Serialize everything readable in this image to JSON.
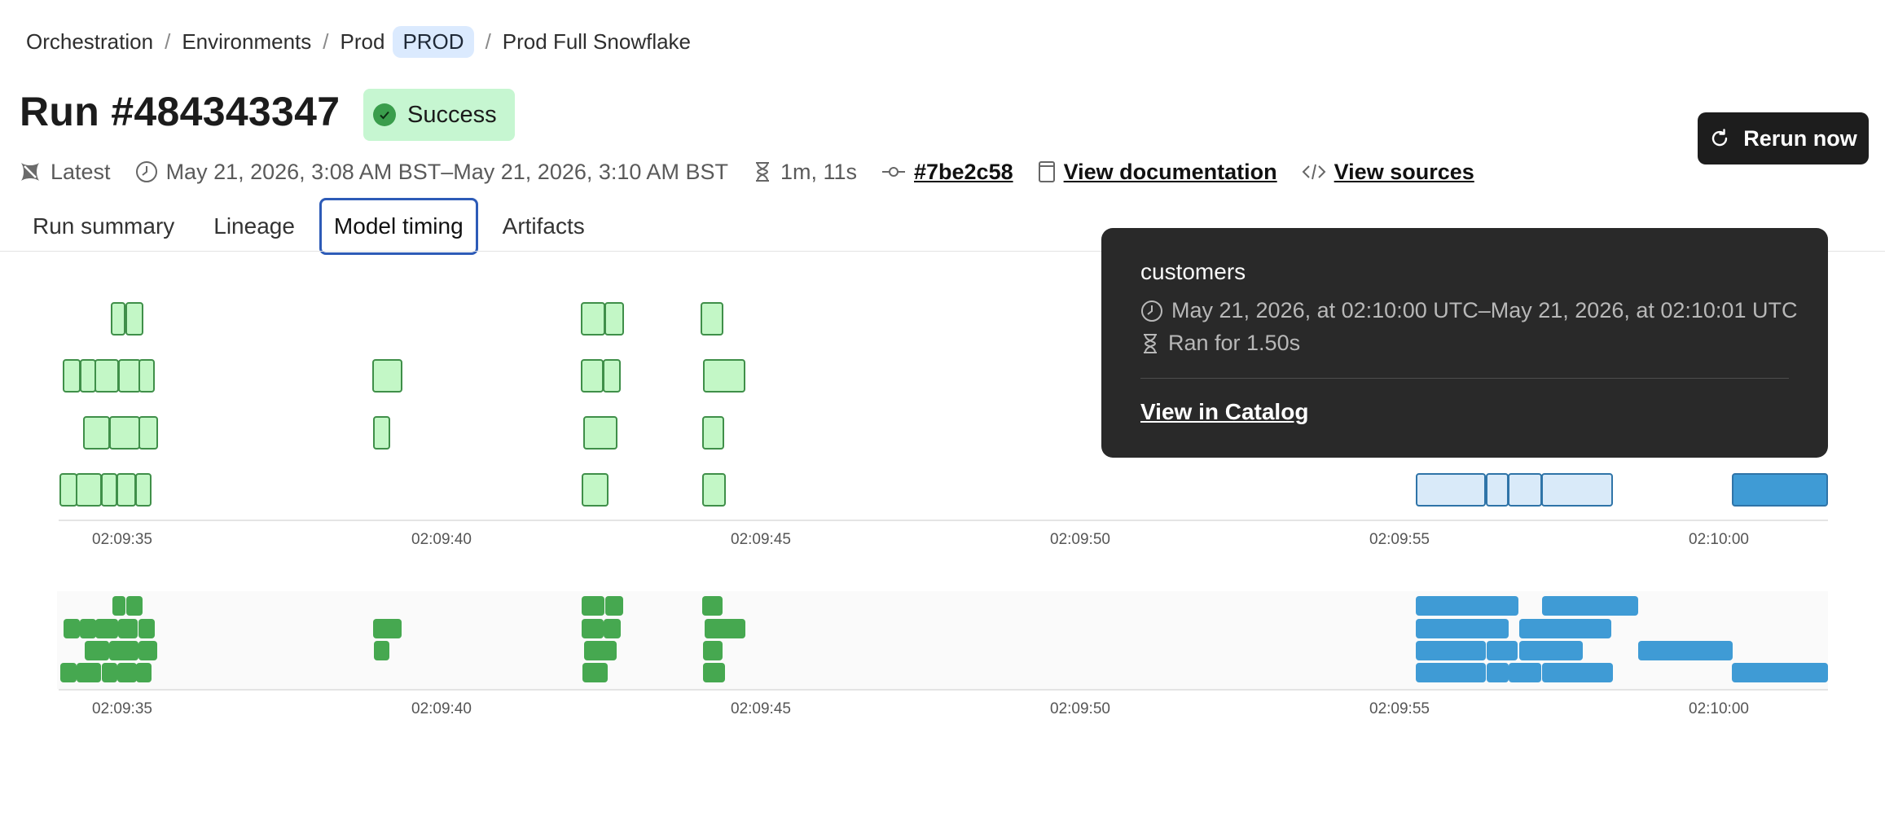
{
  "breadcrumb": {
    "items": [
      "Orchestration",
      "Environments",
      "Prod"
    ],
    "env_badge": "PROD",
    "current": "Prod Full Snowflake",
    "separator": "/"
  },
  "run": {
    "title": "Run #484343347",
    "status": "Success",
    "status_color": "#c6f6d1"
  },
  "actions": {
    "rerun_label": "Rerun now"
  },
  "meta": {
    "version_label": "Latest",
    "time_range": "May 21, 2026, 3:08 AM BST–May 21, 2026, 3:10 AM BST",
    "duration": "1m, 11s",
    "commit": "#7be2c58",
    "docs_link": "View documentation",
    "sources_link": "View sources"
  },
  "tabs": [
    {
      "label": "Run summary",
      "active": false
    },
    {
      "label": "Lineage",
      "active": false
    },
    {
      "label": "Model timing",
      "active": true
    },
    {
      "label": "Artifacts",
      "active": false
    }
  ],
  "tooltip": {
    "title": "customers",
    "time_range": "May 21, 2026, at 02:10:00 UTC–May 21, 2026, at 02:10:01 UTC",
    "duration": "Ran for 1.50s",
    "link": "View in Catalog"
  },
  "timeline": {
    "ticks": [
      "02:09:35",
      "02:09:40",
      "02:09:45",
      "02:09:50",
      "02:09:55",
      "02:10:00"
    ],
    "colors": {
      "completed": "#46a850",
      "completed_light": "#c3f7c6",
      "selected": "#3f9bd5",
      "other": "#d9eaf9"
    }
  }
}
